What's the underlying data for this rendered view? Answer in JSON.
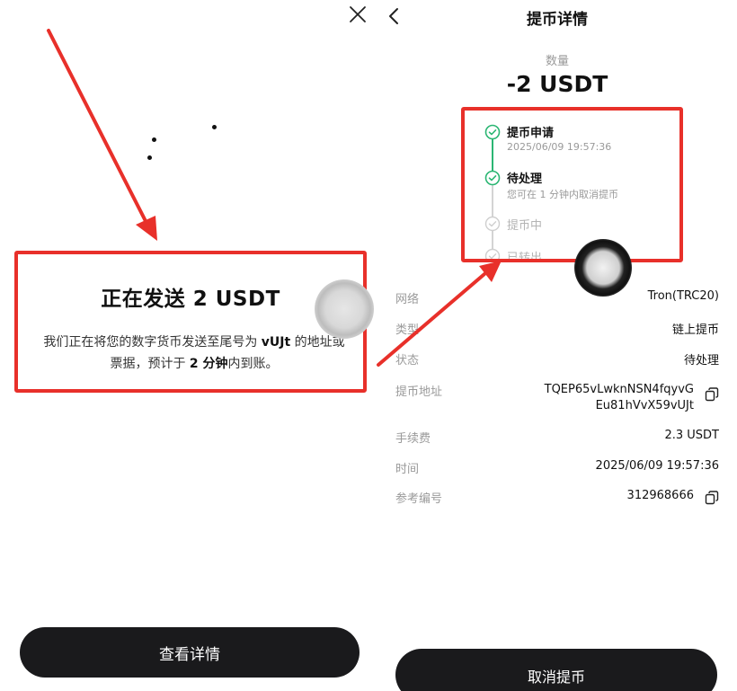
{
  "colors": {
    "highlight_red": "#e8302a",
    "success_green": "#2bb673",
    "button_dark": "#1a1a1c",
    "muted_text": "#9a9a9a"
  },
  "left_panel": {
    "close_icon": "close-icon",
    "sending": {
      "title": "正在发送 2 USDT",
      "desc_part1": "我们正在将您的数字货币发送至尾号为 ",
      "desc_tail": "vUJt",
      "desc_part2": " 的地址或票据，预计于 ",
      "desc_time": "2 分钟",
      "desc_part3": "内到账。"
    },
    "view_details_button": "查看详情"
  },
  "right_panel": {
    "back_icon": "chevron-left-icon",
    "title": "提币详情",
    "quantity_label": "数量",
    "quantity_value": "-2 USDT",
    "steps": [
      {
        "name": "提币申请",
        "sub": "2025/06/09 19:57:36",
        "status": "done"
      },
      {
        "name": "待处理",
        "sub": "您可在 1 分钟内取消提币",
        "status": "done"
      },
      {
        "name": "提币中",
        "status": "pending"
      },
      {
        "name": "已转出",
        "status": "pending"
      }
    ],
    "details": {
      "network": {
        "label": "网络",
        "value": "Tron(TRC20)"
      },
      "type": {
        "label": "类型",
        "value": "链上提币"
      },
      "status": {
        "label": "状态",
        "value": "待处理"
      },
      "address": {
        "label": "提币地址",
        "line1": "TQEP65vLwknNSN4fqyvG",
        "line2": "Eu81hVvX59vUJt"
      },
      "fee": {
        "label": "手续费",
        "value": "2.3 USDT"
      },
      "time": {
        "label": "时间",
        "value": "2025/06/09 19:57:36"
      },
      "ref": {
        "label": "参考编号",
        "value": "312968666"
      }
    },
    "cancel_button": "取消提币"
  }
}
